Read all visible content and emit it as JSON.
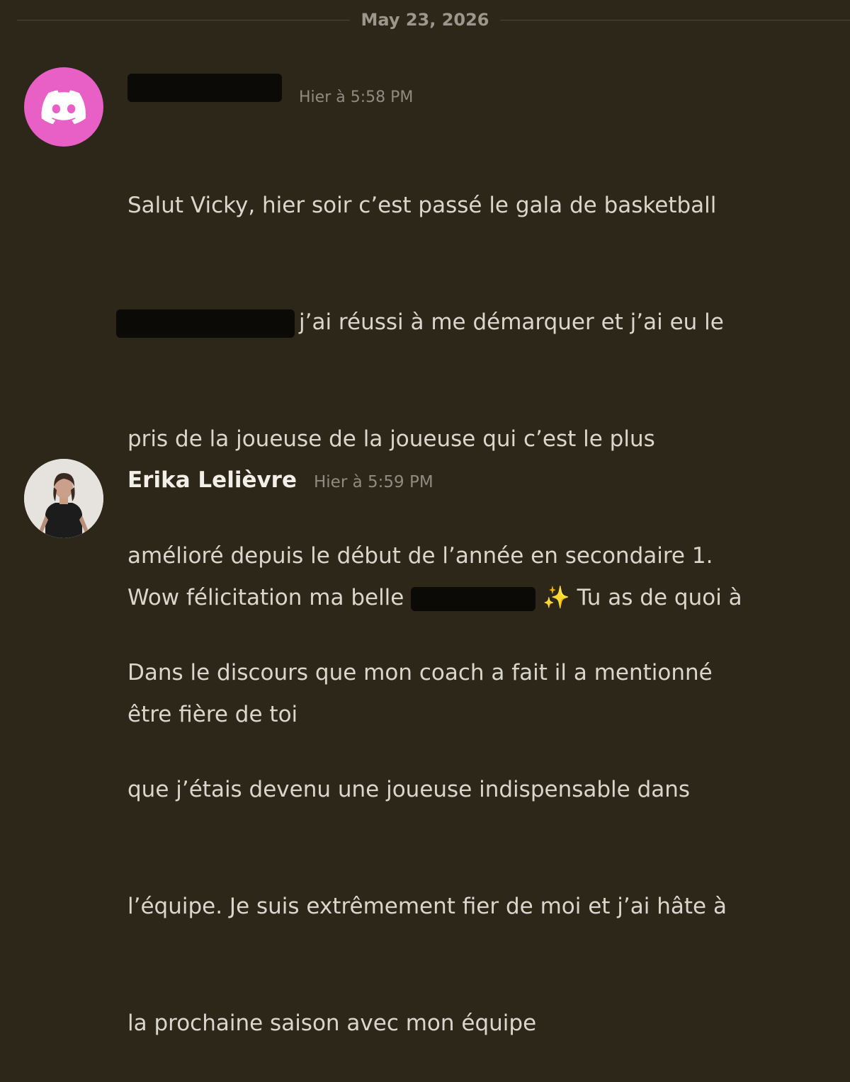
{
  "date_divider": "May 23, 2026",
  "messages": [
    {
      "author": "",
      "author_redacted": true,
      "avatar": "discord-logo-icon",
      "avatar_color": "#e860c6",
      "timestamp": "Hier à 5:58 PM",
      "lines": [
        "Salut Vicky, hier soir c’est passé le gala de basketball",
        "j’ai réussi à me démarquer et j’ai eu le",
        "pris de la joueuse de la joueuse qui c’est le plus",
        "amélioré depuis le début de l’année en secondaire 1.",
        "Dans le discours que mon coach a fait il a mentionné",
        "que j’étais devenu une joueuse indispensable dans",
        "l’équipe. Je suis extrêmement fier de moi et j’ai hâte à",
        "la prochaine saison avec mon équipe"
      ]
    },
    {
      "author": "Erika Lelièvre",
      "avatar": "profile-photo",
      "timestamp": "Hier à 5:59 PM",
      "line1_before": "Wow félicitation ma belle",
      "line1_after": "Tu as de quoi à",
      "line2": "être fière de toi",
      "emoji": "✨"
    }
  ]
}
